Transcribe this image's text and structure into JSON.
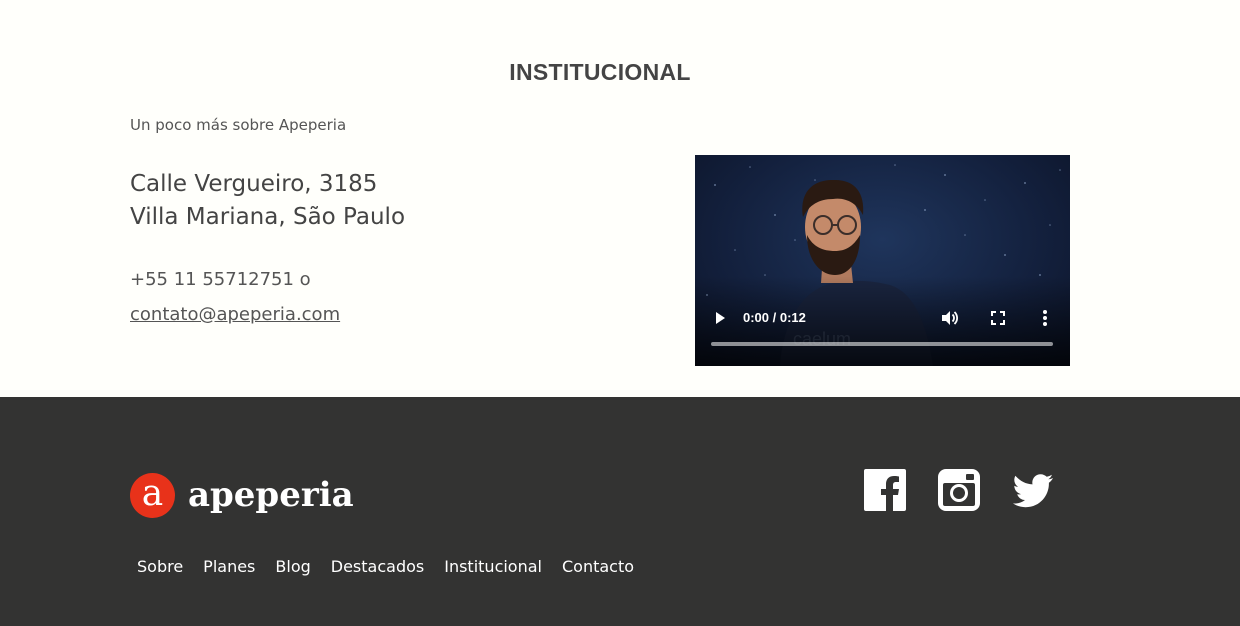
{
  "institucional": {
    "title": "INSTITUCIONAL",
    "subtitle": "Un poco más sobre Apeperia",
    "address_line1": "Calle Vergueiro, 3185",
    "address_line2": "Villa Mariana, São Paulo",
    "phone": "+55 11 55712751 o",
    "email": "contato@apeperia.com"
  },
  "video": {
    "time": "0:00 / 0:12",
    "watermark": "caelum",
    "icons": {
      "play": "play-icon",
      "volume": "volume-icon",
      "fullscreen": "fullscreen-icon",
      "menu": "more-vert-icon"
    },
    "progress": 0
  },
  "footer": {
    "brand_letter": "a",
    "brand_name": "apeperia",
    "nav": [
      "Sobre",
      "Planes",
      "Blog",
      "Destacados",
      "Institucional",
      "Contacto"
    ],
    "social": [
      "facebook-icon",
      "instagram-icon",
      "twitter-icon"
    ]
  },
  "colors": {
    "page_background": "#fffffb",
    "footer_background": "#333332",
    "brand_red": "#e8321a",
    "text_dark": "#444444"
  }
}
